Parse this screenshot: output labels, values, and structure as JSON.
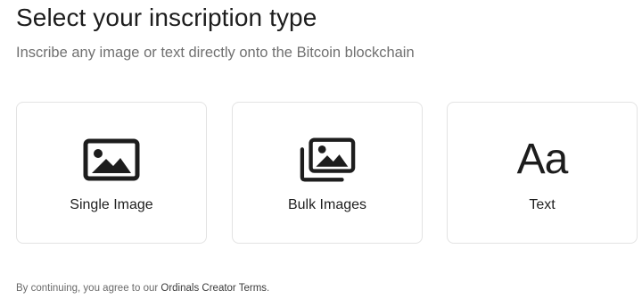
{
  "header": {
    "title": "Select your inscription type",
    "subtitle": "Inscribe any image or text directly onto the Bitcoin blockchain"
  },
  "options": [
    {
      "label": "Single Image",
      "icon": "image-icon"
    },
    {
      "label": "Bulk Images",
      "icon": "images-stack-icon"
    },
    {
      "label": "Text",
      "icon": "text-aa-icon",
      "glyph": "Aa"
    }
  ],
  "footer": {
    "prefix": "By continuing, you agree to our ",
    "link_label": "Ordinals Creator Terms",
    "suffix": "."
  },
  "colors": {
    "text_primary": "#1d1d1d",
    "text_secondary": "#707070",
    "card_border": "#e3e3e3"
  }
}
